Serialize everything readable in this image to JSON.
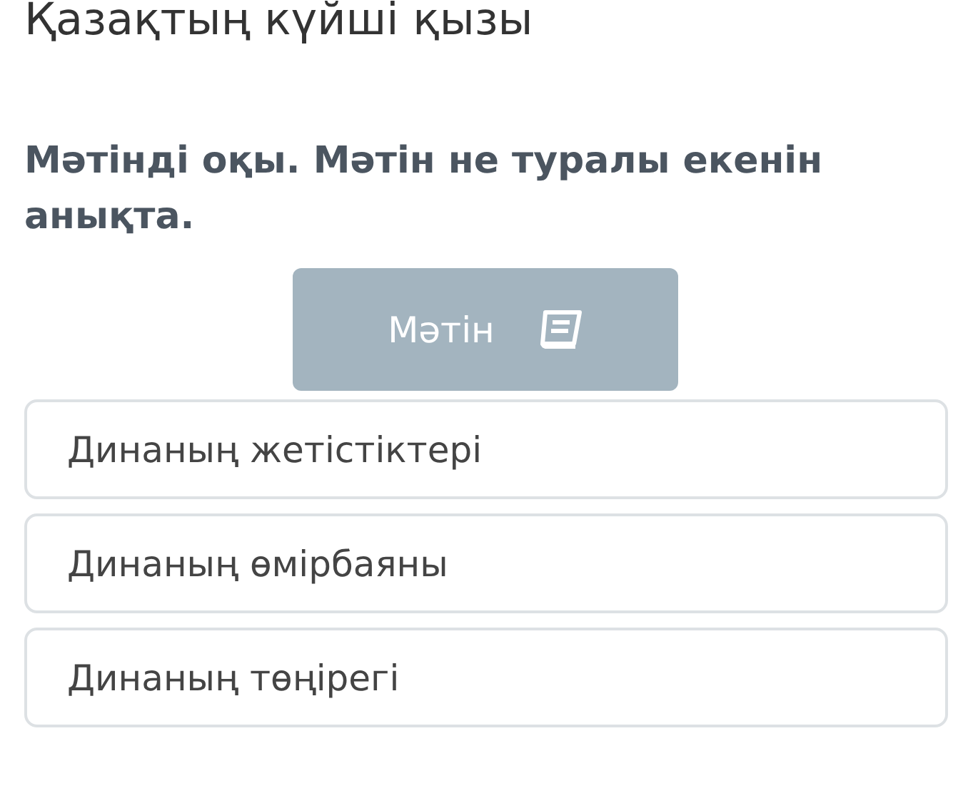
{
  "title": "Қазақтың күйші қызы",
  "question": "Мәтінді оқы. Мәтін не туралы екенін анықта.",
  "text_button": {
    "label": "Мәтін"
  },
  "options": [
    {
      "label": "Динаның жетістіктері"
    },
    {
      "label": "Динаның өмірбаяны"
    },
    {
      "label": "Динаның төңірегі"
    }
  ]
}
